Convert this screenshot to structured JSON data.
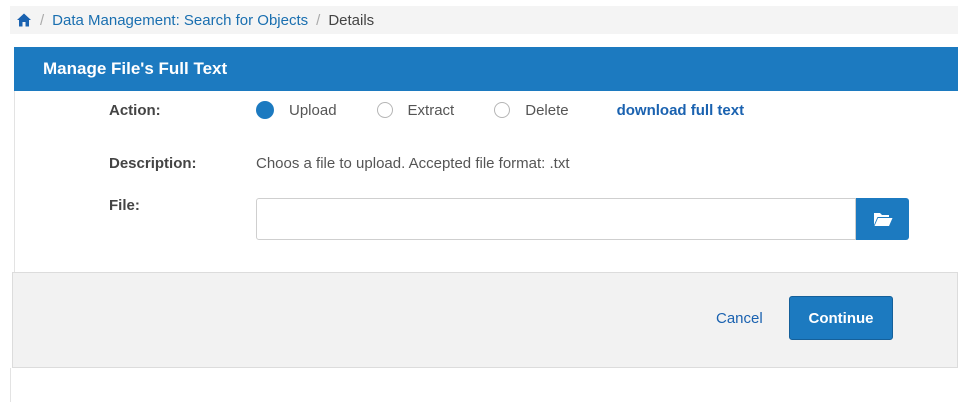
{
  "breadcrumb": {
    "home_icon": "home-icon",
    "items": [
      "Data Management: Search for Objects",
      "Details"
    ],
    "separator": "/"
  },
  "panel": {
    "title": "Manage File's Full Text"
  },
  "form": {
    "action_label": "Action:",
    "actions": [
      {
        "label": "Upload",
        "selected": true
      },
      {
        "label": "Extract",
        "selected": false
      },
      {
        "label": "Delete",
        "selected": false
      }
    ],
    "download_link": "download full text",
    "description_label": "Description:",
    "description_text": "Choos a file to upload. Accepted file format: .txt",
    "file_label": "File:",
    "file_value": "",
    "browse_icon": "folder-open-icon"
  },
  "footer": {
    "cancel_label": "Cancel",
    "continue_label": "Continue"
  },
  "colors": {
    "accent": "#1c7ac0",
    "link": "#1a62b0"
  }
}
